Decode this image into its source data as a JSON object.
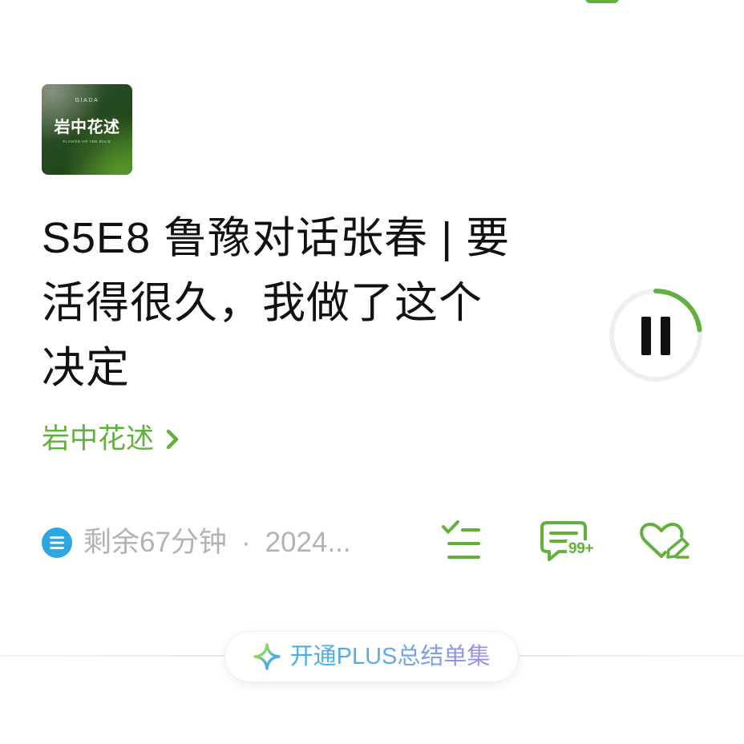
{
  "colors": {
    "accent_green": "#62b13e",
    "meta_gray": "#b3b3b3",
    "info_blue": "#2ea7e0",
    "title_black": "#111111",
    "promo_gradient_start": "#3fb2e3",
    "promo_gradient_end": "#a58ee3"
  },
  "top_bar": {
    "icon": "cropped-toolbar-icon"
  },
  "cover": {
    "brand": "GIADA",
    "title": "岩中花述",
    "subtitle": "FLOWER ON THE ROCK"
  },
  "episode": {
    "title_lines": [
      "S5E8 鲁豫对话张春 | 要",
      "活得很久，我做了这个",
      "决定"
    ]
  },
  "player": {
    "state_icon": "pause-icon",
    "progress": 0.23
  },
  "podcast": {
    "name": "岩中花述",
    "chevron_icon": "chevron-right-icon"
  },
  "meta": {
    "icon": "list-circle-icon",
    "remaining": "剩余67分钟",
    "separator": "·",
    "date": "2024..."
  },
  "actions": {
    "playlist_icon": "checklist-icon",
    "comment_icon": "comment-icon",
    "comment_badge": "99+",
    "favorite_icon": "heart-edit-icon"
  },
  "promo": {
    "icon": "sparkle-icon",
    "label": "开通PLUS总结单集"
  }
}
